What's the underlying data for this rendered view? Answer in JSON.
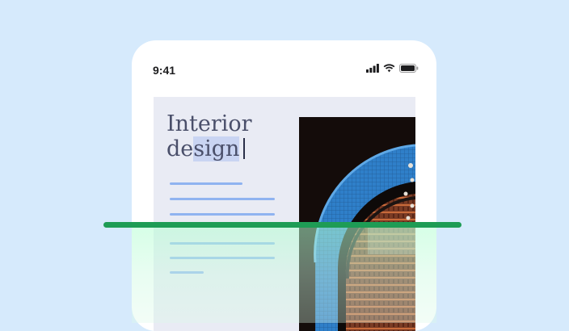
{
  "status_bar": {
    "time": "9:41",
    "icons": [
      "cellular-signal-icon",
      "wifi-icon",
      "battery-icon"
    ]
  },
  "document": {
    "title_line_1": "Interior",
    "title_line_2_plain": "de",
    "title_line_2_selected": "sign",
    "image": "interior-arch-window-photo"
  },
  "colors": {
    "background": "#d6eafc",
    "scan_line": "#1e9c55",
    "text_lines": "#8fb3f0",
    "selection": "#c9d4f2"
  }
}
